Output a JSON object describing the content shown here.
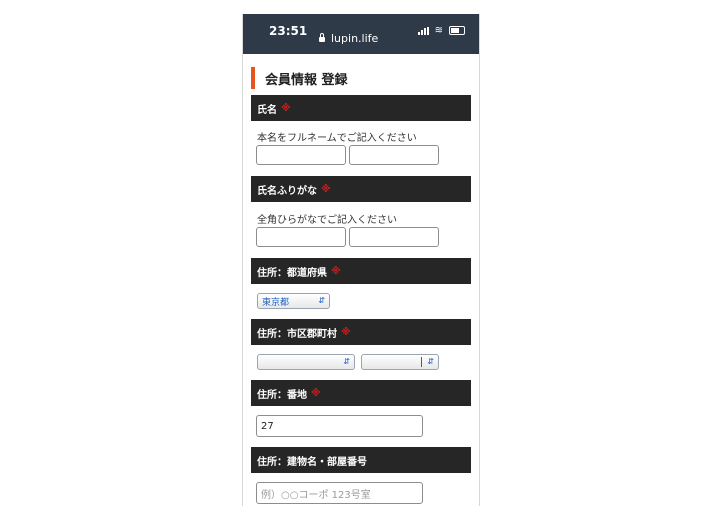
{
  "status_bar": {
    "time": "23:51",
    "url": "lupin.life"
  },
  "page": {
    "title": "会員情報 登録"
  },
  "required_mark": "※",
  "sections": {
    "name": {
      "label": "氏名",
      "hint": "本名をフルネームでご記入ください",
      "last_value": "",
      "first_value": ""
    },
    "kana": {
      "label": "氏名ふりがな",
      "hint": "全角ひらがなでご記入ください",
      "last_value": "",
      "first_value": ""
    },
    "prefecture": {
      "label": "住所：都道府県",
      "selected": "東京都"
    },
    "city": {
      "label": "住所：市区郡町村",
      "select1": "",
      "select2": ""
    },
    "street": {
      "label": "住所：番地",
      "value": "27"
    },
    "building": {
      "label": "住所：建物名・部屋番号",
      "placeholder": "例）○○コーポ 123号室"
    }
  }
}
